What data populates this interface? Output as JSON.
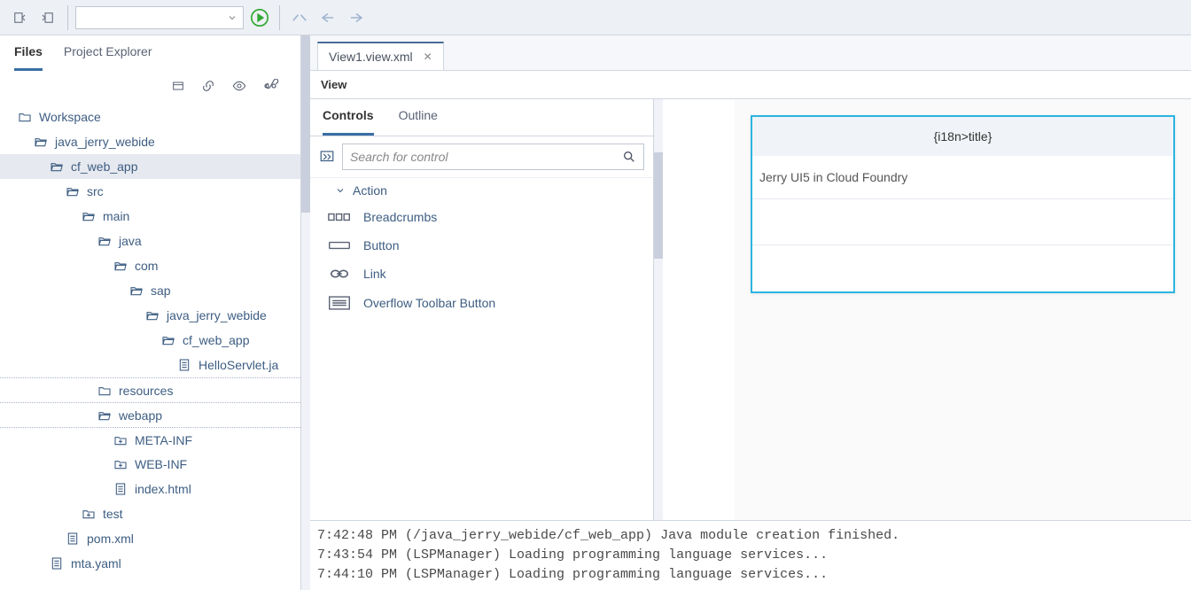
{
  "toolbar": {
    "combo_value": ""
  },
  "sidebar": {
    "tabs": {
      "files": "Files",
      "explorer": "Project Explorer"
    },
    "tree": {
      "root": "Workspace",
      "p1": "java_jerry_webide",
      "p2": "cf_web_app",
      "src": "src",
      "main": "main",
      "java": "java",
      "com": "com",
      "sap": "sap",
      "pkg": "java_jerry_webide",
      "pkg2": "cf_web_app",
      "hello": "HelloServlet.ja",
      "resources": "resources",
      "webapp": "webapp",
      "metainf": "META-INF",
      "webinf": "WEB-INF",
      "index": "index.html",
      "test": "test",
      "pom": "pom.xml",
      "mta": "mta.yaml"
    }
  },
  "editor": {
    "tab": "View1.view.xml",
    "view_label": "View"
  },
  "controls": {
    "tab_controls": "Controls",
    "tab_outline": "Outline",
    "search_placeholder": "Search for control",
    "section_action": "Action",
    "breadcrumbs": "Breadcrumbs",
    "button": "Button",
    "link": "Link",
    "overflow": "Overflow Toolbar Button"
  },
  "preview": {
    "title": "{i18n>title}",
    "line": "Jerry UI5 in Cloud Foundry"
  },
  "console": {
    "l1": "7:42:48 PM (/java_jerry_webide/cf_web_app) Java module creation finished.",
    "l2": "7:43:54 PM (LSPManager) Loading programming language services...",
    "l3": "7:44:10 PM (LSPManager) Loading programming language services..."
  }
}
